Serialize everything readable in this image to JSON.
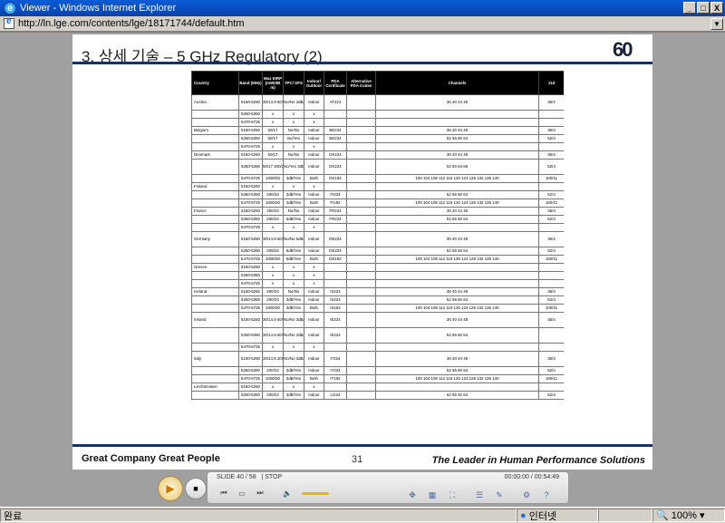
{
  "window": {
    "title": "Viewer - Windows Internet Explorer",
    "minimize": "_",
    "maximize": "□",
    "close": "X"
  },
  "address": {
    "url": "http://ln.lge.com/contents/lge/18171744/default.htm"
  },
  "slide": {
    "title": "3. 상세 기술 – 5 GHz Regulatory (2)",
    "logo_text": "60",
    "footer_left": "Great Company   Great People",
    "page_number": "31",
    "footer_right": "The Leader in Human Performance Solutions"
  },
  "table": {
    "headers": [
      "Country",
      "Band (MHz)",
      "Max EIRP (mW/dB m)",
      "TPC/ DFS",
      "Indoor/ Outdoor",
      "PDA Certificate",
      "Alternative PDA Codes",
      "Channels",
      "11d"
    ],
    "rows": [
      [
        "Austria",
        "5150-5250",
        "30/14.9 60/17.8",
        "No/No 3dB/No",
        "Indoor",
        "AT224",
        "",
        "36 40 44 48",
        "36/4"
      ],
      [
        "",
        "5250-5350",
        "x",
        "x",
        "x",
        "",
        "",
        "",
        ""
      ],
      [
        "",
        "5470-5725",
        "x",
        "x",
        "x",
        "",
        "",
        "",
        ""
      ],
      [
        "Belgium",
        "5150-5250",
        "50/17",
        "No/No",
        "Indoor",
        "BE224",
        "",
        "36 40 44 48",
        "36/4"
      ],
      [
        "",
        "5250-5350",
        "50/17",
        "No/Yes",
        "Indoor",
        "BE224",
        "",
        "52 56 60 64",
        "52/4"
      ],
      [
        "",
        "5470-5725",
        "x",
        "x",
        "x",
        "",
        "",
        "",
        ""
      ],
      [
        "Denmark",
        "5150-5250",
        "50/17",
        "No/No",
        "Indoor",
        "DK224",
        "",
        "36 40 44 48",
        "36/4"
      ],
      [
        "",
        "5250-5350",
        "50/17 200/23",
        "No/Yes 3dB/Yes",
        "Indoor",
        "DK224",
        "",
        "52 60 64 68",
        "52/4"
      ],
      [
        "",
        "5470-5725",
        "1000/30",
        "3dB/Yes",
        "Both",
        "DK192",
        "",
        "100 104 108 112 116 120 124 128 132 136 140",
        "100/11"
      ],
      [
        "Finland",
        "5150-5250",
        "x",
        "x",
        "x",
        "",
        "",
        "",
        ""
      ],
      [
        "",
        "5250-5350",
        "200/23",
        "3dB/Yes",
        "Indoor",
        "FI224",
        "",
        "52 56 60 64",
        "52/4"
      ],
      [
        "",
        "5470-5725",
        "1000/30",
        "3dB/Yes",
        "Both",
        "FI192",
        "",
        "100 104 108 112 116 120 124 128 132 136 140",
        "100/11"
      ],
      [
        "France",
        "5150-5250",
        "200/23",
        "No/No",
        "Indoor",
        "FR224",
        "",
        "36 40 44 48",
        "36/4"
      ],
      [
        "",
        "5250-5350",
        "200/23",
        "6dB/Yes",
        "Indoor",
        "FR224",
        "",
        "52 56 60 64",
        "52/4"
      ],
      [
        "",
        "5470-5725",
        "x",
        "x",
        "x",
        "",
        "",
        "",
        ""
      ],
      [
        "Germany",
        "5150-5250",
        "30/14.8 60/17.8",
        "No/No 6dB/No",
        "Indoor",
        "DE224",
        "",
        "36 40 44 48",
        "36/4"
      ],
      [
        "",
        "5250-5350",
        "200/23",
        "6dB/Yes",
        "Indoor",
        "DE224",
        "",
        "52 56 60 64",
        "52/4"
      ],
      [
        "",
        "5470-5725",
        "1000/30",
        "6dB/Yes",
        "Both",
        "DE192",
        "",
        "100 104 108 112 116 120 124 128 132 136 140",
        "100/11"
      ],
      [
        "Greece",
        "5150-5250",
        "x",
        "x",
        "x",
        "",
        "",
        "",
        ""
      ],
      [
        "",
        "5250-5350",
        "x",
        "x",
        "x",
        "",
        "",
        "",
        ""
      ],
      [
        "",
        "5470-5725",
        "x",
        "x",
        "x",
        "",
        "",
        "",
        ""
      ],
      [
        "Iceland",
        "5150-5250",
        "200/23",
        "No/No",
        "Indoor",
        "IS224",
        "",
        "36 40 44 48",
        "36/4"
      ],
      [
        "",
        "5250-5350",
        "200/23",
        "3dB/Yes",
        "Indoor",
        "IS224",
        "",
        "52 56 60 64",
        "52/4"
      ],
      [
        "",
        "5470-5725",
        "1000/30",
        "3dB/Yes",
        "Both",
        "IS192",
        "",
        "100 104 108 112 116 120 124 128 132 136 140",
        "100/11"
      ],
      [
        "Ireland",
        "5150-5250",
        "30/14.8 60/17.8",
        "No/No 3dB/No",
        "Indoor",
        "IE224",
        "",
        "36 40 44 48",
        "36/4"
      ],
      [
        "",
        "5250-5350",
        "30/14.8 60/17.8",
        "No/No 3dB/No",
        "Indoor",
        "IE224",
        "",
        "52 56 60 64",
        ""
      ],
      [
        "",
        "5470-5725",
        "x",
        "x",
        "x",
        "",
        "",
        "",
        ""
      ],
      [
        "Italy",
        "5150-5250",
        "30/14.8 200/23",
        "No/No 3dB/No",
        "Indoor",
        "IT224",
        "",
        "36 40 44 48",
        "36/4"
      ],
      [
        "",
        "5250-5350",
        "200/23",
        "3dB/Yes",
        "Indoor",
        "IT224",
        "",
        "52 56 60 64",
        "52/4"
      ],
      [
        "",
        "5470-5725",
        "1000/30",
        "3dB/Yes",
        "Both",
        "IT192",
        "",
        "100 104 108 112 116 120 124 128 132 136 140",
        "100/11"
      ],
      [
        "Liechtenstein",
        "5150-5250",
        "x",
        "x",
        "x",
        "",
        "",
        "",
        ""
      ],
      [
        "",
        "5250-5350",
        "200/23",
        "3dB/Yes",
        "Indoor",
        "LI224",
        "",
        "52 56 60 64",
        "52/4"
      ]
    ],
    "tall_rows": [
      0,
      7,
      15,
      24,
      25,
      27
    ]
  },
  "player": {
    "slide_info": "SLIDE 40 / 58",
    "state": "| STOP",
    "time": "00:00:00 / 00:54:49",
    "play_icon": "play-icon",
    "stop_icon": "stop-icon"
  },
  "statusbar": {
    "left": "완료",
    "zone": "인터넷",
    "zoom": "100%"
  }
}
